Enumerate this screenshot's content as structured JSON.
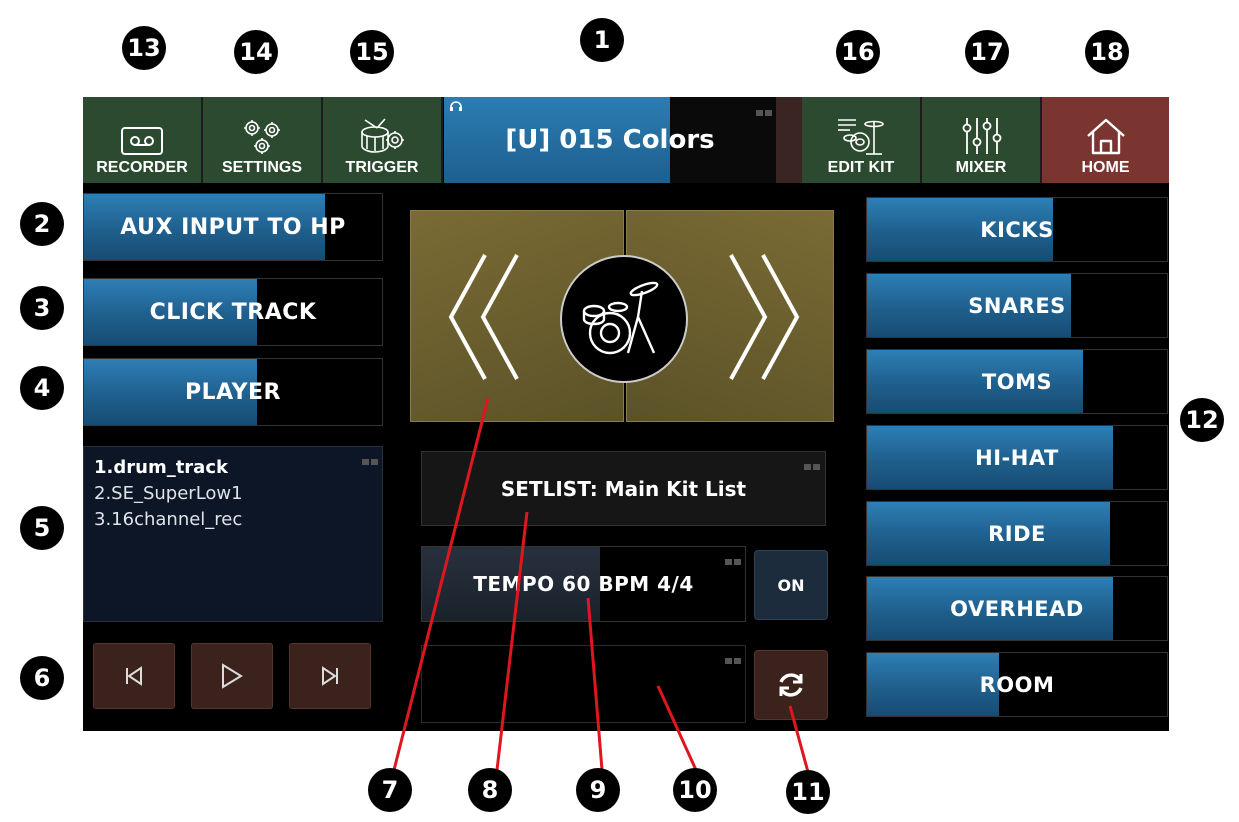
{
  "callouts": [
    "1",
    "2",
    "3",
    "4",
    "5",
    "6",
    "7",
    "8",
    "9",
    "10",
    "11",
    "12",
    "13",
    "14",
    "15",
    "16",
    "17",
    "18"
  ],
  "toolbar": {
    "recorder": "RECORDER",
    "settings": "SETTINGS",
    "trigger": "TRIGGER",
    "kit_name": "[U] 015 Colors",
    "edit_kit": "EDIT KIT",
    "mixer": "MIXER",
    "home": "HOME"
  },
  "left_faders": [
    {
      "label": "AUX INPUT TO HP",
      "level": 0.81
    },
    {
      "label": "CLICK TRACK",
      "level": 0.58
    },
    {
      "label": "PLAYER",
      "level": 0.58
    }
  ],
  "tracks": [
    "1.drum_track",
    "2.SE_SuperLow1",
    "3.16channel_rec"
  ],
  "setlist": "SETLIST: Main Kit List",
  "tempo": {
    "label": "TEMPO 60 BPM 4/4",
    "on_label": "ON",
    "level": 0.55
  },
  "right_faders": [
    {
      "label": "KICKS",
      "level": 0.62
    },
    {
      "label": "SNARES",
      "level": 0.68
    },
    {
      "label": "TOMS",
      "level": 0.72
    },
    {
      "label": "HI-HAT",
      "level": 0.82
    },
    {
      "label": "RIDE",
      "level": 0.81
    },
    {
      "label": "OVERHEAD",
      "level": 0.82
    },
    {
      "label": "ROOM",
      "level": 0.44
    }
  ],
  "colors": {
    "fader_blue": "#2578b0",
    "toolbar_green": "#2c4a30",
    "home_red": "#7a3530",
    "kit_olive": "#6b5f2e",
    "annotation_red": "#e0161f"
  },
  "icons": [
    "cassette-icon",
    "gears-icon",
    "drum-gear-icon",
    "headphone-icon",
    "edit-kit-icon",
    "mixer-sliders-icon",
    "home-icon",
    "drum-kit-icon",
    "prev-chevron-icon",
    "next-chevron-icon",
    "skip-back-icon",
    "play-icon",
    "skip-forward-icon",
    "refresh-icon"
  ]
}
